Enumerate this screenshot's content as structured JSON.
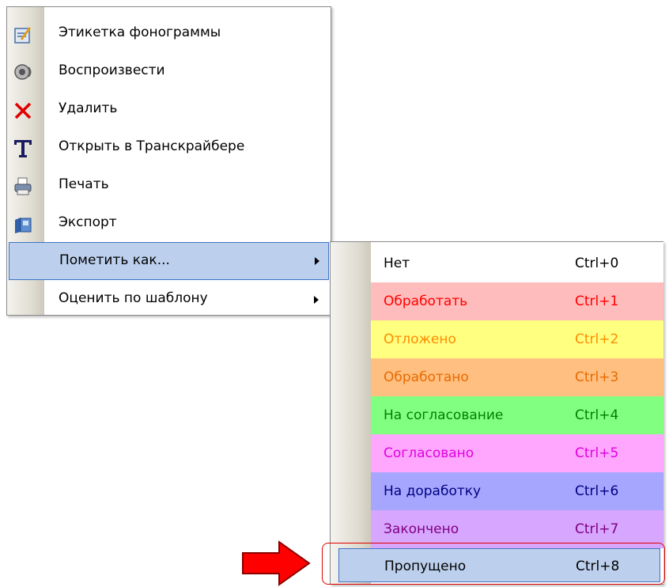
{
  "main_menu": {
    "items": [
      {
        "label": "Этикетка фонограммы",
        "icon": "label-edit-icon"
      },
      {
        "label": "Воспроизвести",
        "icon": "speaker-icon"
      },
      {
        "label": "Удалить",
        "icon": "delete-x-icon"
      },
      {
        "label": "Открыть в Транскрайбере",
        "icon": "transcriber-t-icon"
      },
      {
        "label": "Печать",
        "icon": "printer-icon"
      },
      {
        "label": "Экспорт",
        "icon": "export-icon"
      },
      {
        "label": "Пометить как...",
        "submenu": true,
        "highlighted": true
      },
      {
        "label": "Оценить по шаблону",
        "submenu": true
      }
    ]
  },
  "mark_as_submenu": {
    "items": [
      {
        "label": "Нет",
        "shortcut": "Ctrl+0",
        "bg": "#ffffff",
        "color": "#000000"
      },
      {
        "label": "Обработать",
        "shortcut": "Ctrl+1",
        "bg": "#ffbcbc",
        "color": "#ff0000"
      },
      {
        "label": "Отложено",
        "shortcut": "Ctrl+2",
        "bg": "#ffff80",
        "color": "#ff8c00"
      },
      {
        "label": "Обработано",
        "shortcut": "Ctrl+3",
        "bg": "#ffbf80",
        "color": "#e86a00"
      },
      {
        "label": "На согласование",
        "shortcut": "Ctrl+4",
        "bg": "#80ff80",
        "color": "#008000"
      },
      {
        "label": "Согласовано",
        "shortcut": "Ctrl+5",
        "bg": "#ffa6ff",
        "color": "#e000e0"
      },
      {
        "label": "На доработку",
        "shortcut": "Ctrl+6",
        "bg": "#a6a6ff",
        "color": "#000080"
      },
      {
        "label": "Закончено",
        "shortcut": "Ctrl+7",
        "bg": "#d7a6ff",
        "color": "#800080"
      },
      {
        "label": "Пропущено",
        "shortcut": "Ctrl+8",
        "bg": "#bcd0ed",
        "color": "#000000",
        "highlighted": true
      }
    ]
  },
  "annotation": {
    "arrow_color": "#ff0000",
    "box_color": "#e00000"
  }
}
